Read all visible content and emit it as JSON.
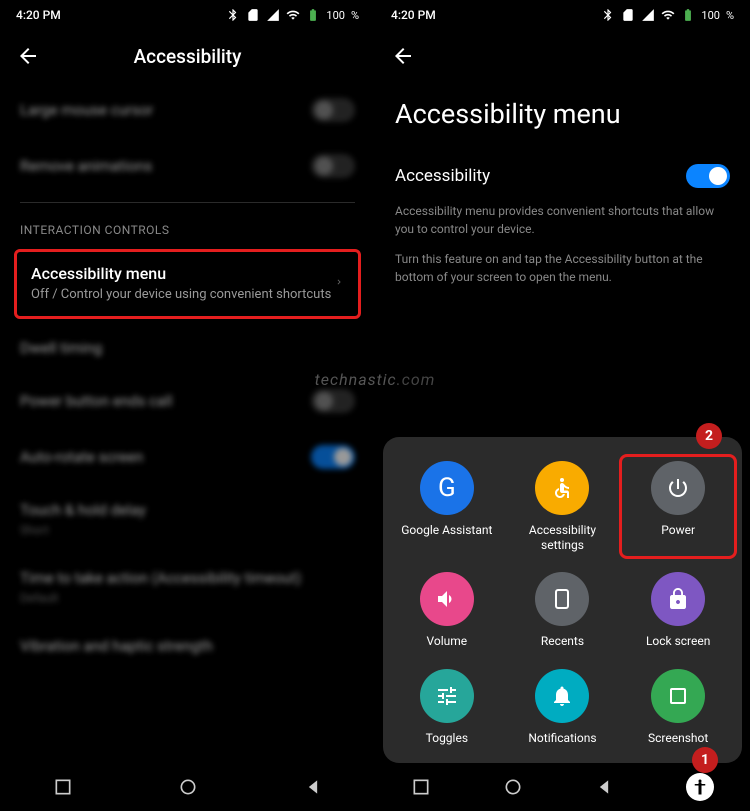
{
  "status": {
    "time": "4:20 PM",
    "battery": "100",
    "battery_unit": "%"
  },
  "left": {
    "title": "Accessibility",
    "items": {
      "large_cursor": "Large mouse cursor",
      "remove_anim": "Remove animations",
      "section": "INTERACTION CONTROLS",
      "acc_menu_title": "Accessibility menu",
      "acc_menu_sub": "Off / Control your device using convenient shortcuts",
      "dwell": "Dwell timing",
      "power_ends": "Power button ends call",
      "auto_rotate": "Auto-rotate screen",
      "touch_hold": "Touch & hold delay",
      "touch_hold_sub": "Short",
      "time_action": "Time to take action (Accessibility timeout)",
      "time_action_sub": "Default",
      "vibration": "Vibration and haptic strength"
    }
  },
  "right": {
    "page_title": "Accessibility menu",
    "toggle_label": "Accessibility",
    "desc1": "Accessibility menu provides convenient shortcuts that allow you to control your device.",
    "desc2": "Turn this feature on and tap the Accessibility button at the bottom of your screen to open the menu.",
    "panel": {
      "assistant": "Google Assistant",
      "acc_settings": "Accessibility settings",
      "power": "Power",
      "volume": "Volume",
      "recents": "Recents",
      "lock": "Lock screen",
      "toggles": "Toggles",
      "notifications": "Notifications",
      "screenshot": "Screenshot"
    }
  },
  "badges": {
    "one": "1",
    "two": "2"
  },
  "watermark": "technastic",
  "watermark_domain": ".com"
}
